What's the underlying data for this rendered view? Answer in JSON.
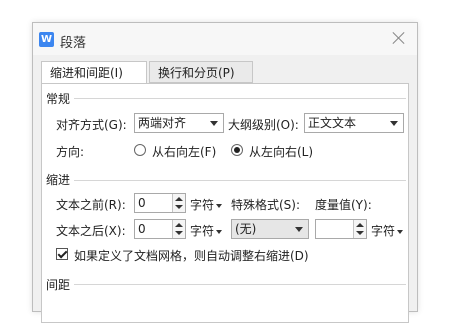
{
  "dialog": {
    "title": "段落",
    "app_icon_letter": "W",
    "tabs": [
      {
        "label": "缩进和间距(I)",
        "active": true
      },
      {
        "label": "换行和分页(P)",
        "active": false
      }
    ]
  },
  "general": {
    "section": "常规",
    "alignment_label": "对齐方式(G):",
    "alignment_value": "两端对齐",
    "outline_label": "大纲级别(O):",
    "outline_value": "正文文本",
    "direction_label": "方向:",
    "rtl_label": "从右向左(F)",
    "ltr_label": "从左向右(L)",
    "selected_direction": "ltr"
  },
  "indent": {
    "section": "缩进",
    "before_label": "文本之前(R):",
    "before_value": "0",
    "after_label": "文本之后(X):",
    "after_value": "0",
    "unit": "字符",
    "special_label": "特殊格式(S):",
    "special_value": "(无)",
    "measure_label": "度量值(Y):",
    "measure_value": "",
    "grid_checkbox_label": "如果定义了文档网格，则自动调整右缩进(D)",
    "grid_checked": true
  },
  "spacing": {
    "section": "间距"
  }
}
